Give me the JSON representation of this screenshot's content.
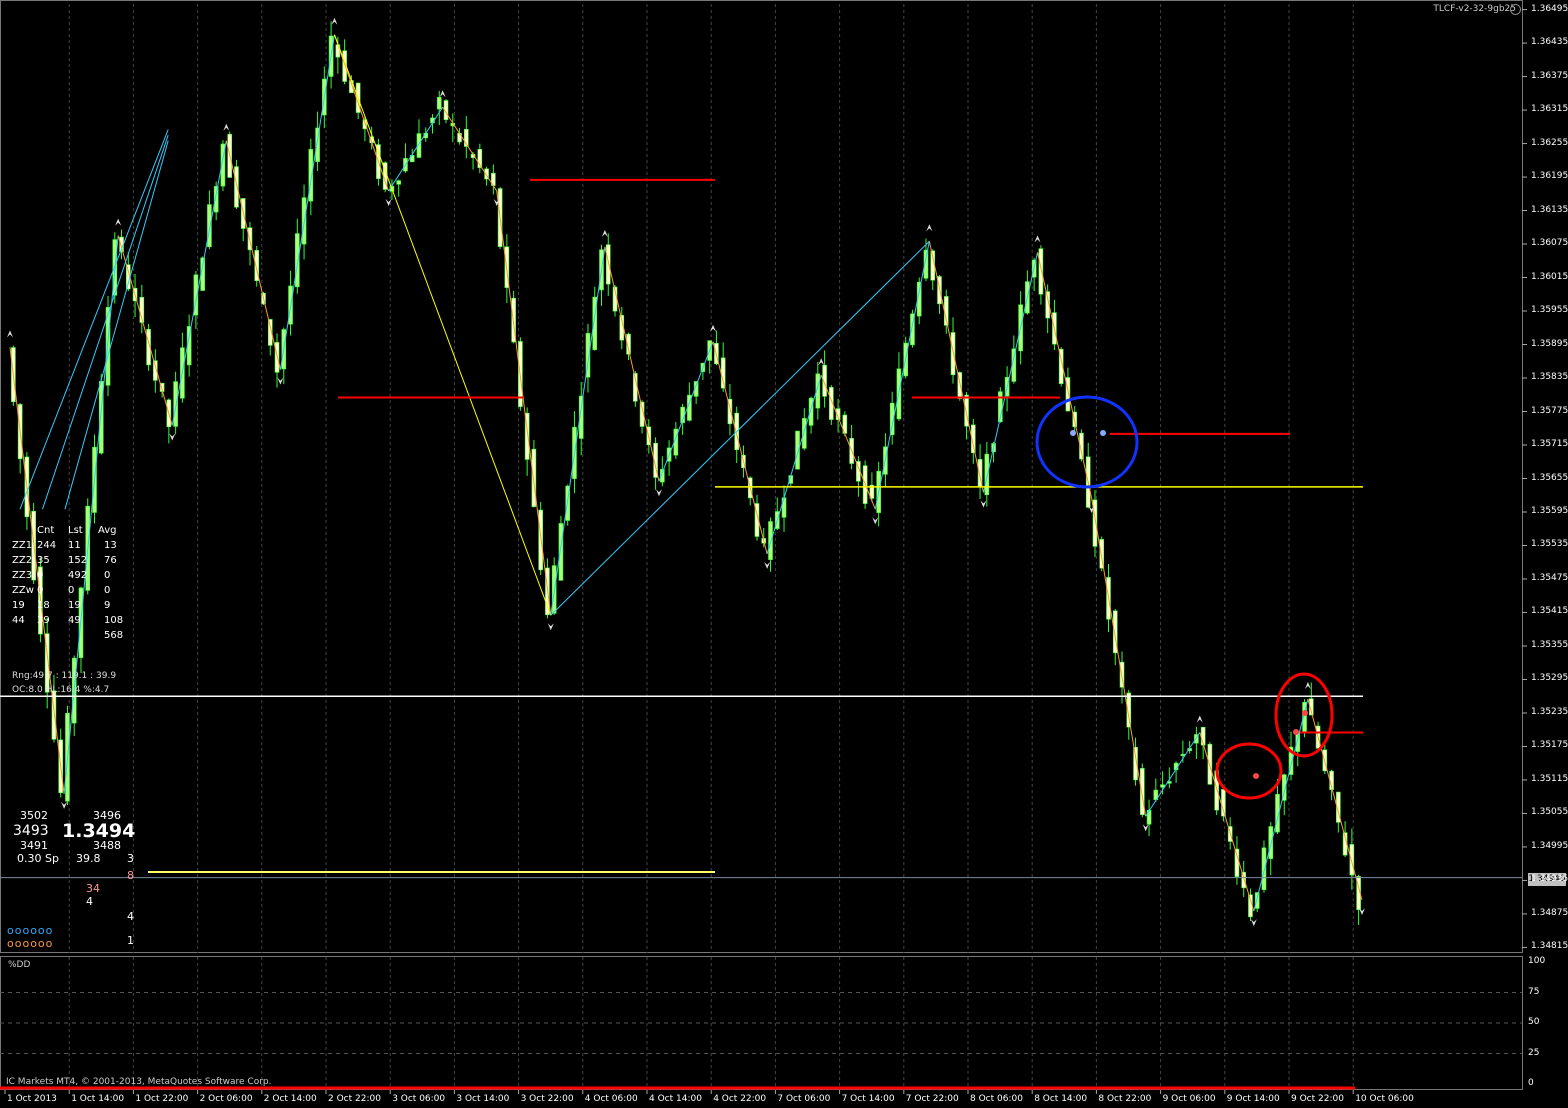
{
  "window": {
    "title": "TLCF-v2-32-9gb25",
    "copyright": "IC Markets MT4, © 2001-2013, MetaQuotes Software Corp."
  },
  "chart_data": {
    "type": "candlestick",
    "price_axis": [
      "1.36495",
      "1.36435",
      "1.36375",
      "1.36315",
      "1.36255",
      "1.36195",
      "1.36135",
      "1.36075",
      "1.36015",
      "1.35955",
      "1.35895",
      "1.35835",
      "1.35775",
      "1.35715",
      "1.35655",
      "1.35595",
      "1.35535",
      "1.35475",
      "1.35415",
      "1.35355",
      "1.35295",
      "1.35235",
      "1.35175",
      "1.35115",
      "1.35055",
      "1.34995",
      "1.34935",
      "1.34875",
      "1.34815"
    ],
    "ylim": [
      1.34805,
      1.36505
    ],
    "current_price": "1.34940",
    "time_axis": [
      "1 Oct 2013",
      "1 Oct 14:00",
      "1 Oct 22:00",
      "2 Oct 06:00",
      "2 Oct 14:00",
      "2 Oct 22:00",
      "3 Oct 06:00",
      "3 Oct 14:00",
      "3 Oct 22:00",
      "4 Oct 06:00",
      "4 Oct 14:00",
      "4 Oct 22:00",
      "7 Oct 06:00",
      "7 Oct 14:00",
      "7 Oct 22:00",
      "8 Oct 06:00",
      "8 Oct 14:00",
      "8 Oct 22:00",
      "9 Oct 06:00",
      "9 Oct 14:00",
      "9 Oct 22:00",
      "10 Oct 06:00"
    ],
    "zigzag_points": [
      [
        0,
        1.3589
      ],
      [
        1,
        1.3509
      ],
      [
        2,
        1.3609
      ],
      [
        3,
        1.3575
      ],
      [
        4,
        1.3626
      ],
      [
        5,
        1.3585
      ],
      [
        6,
        1.3645
      ],
      [
        7,
        1.3617
      ],
      [
        8,
        1.3632
      ],
      [
        9,
        1.3617
      ],
      [
        10,
        1.3541
      ],
      [
        11,
        1.3607
      ],
      [
        12,
        1.3565
      ],
      [
        13,
        1.359
      ],
      [
        14,
        1.3552
      ],
      [
        15,
        1.3584
      ],
      [
        16,
        1.356
      ],
      [
        17,
        1.3608
      ],
      [
        18,
        1.3563
      ],
      [
        19,
        1.3606
      ],
      [
        20,
        1.3562
      ],
      [
        21,
        1.3505
      ],
      [
        22,
        1.352
      ],
      [
        23,
        1.3488
      ],
      [
        24,
        1.3526
      ],
      [
        25,
        1.349
      ]
    ],
    "horizontal_levels": [
      {
        "price": 1.3619,
        "color": "#ff0000"
      },
      {
        "price": 1.358,
        "color": "#ff0000"
      },
      {
        "price": 1.358,
        "color": "#ff0000"
      },
      {
        "price": 1.35735,
        "color": "#ff0000"
      },
      {
        "price": 1.3564,
        "color": "#ffff00"
      },
      {
        "price": 1.35265,
        "color": "#ffffff"
      },
      {
        "price": 1.352,
        "color": "#ff0000"
      },
      {
        "price": 1.3495,
        "color": "#ffff66"
      }
    ],
    "indicator": {
      "name": "%DD",
      "ticks": [
        "100",
        "75",
        "50",
        "25",
        "0"
      ]
    }
  },
  "stats": {
    "headers": [
      "Cnt",
      "Lst",
      "Avg"
    ],
    "rows": [
      [
        "ZZ1",
        "244",
        "11",
        "13"
      ],
      [
        "ZZ2",
        "35",
        "152",
        "76"
      ],
      [
        "ZZ3",
        "0",
        "492",
        "0"
      ],
      [
        "ZZw",
        "0",
        "0",
        "0"
      ],
      [
        "19",
        "18",
        "19",
        "9"
      ],
      [
        "44",
        "39",
        "49",
        "108"
      ]
    ],
    "total": "568",
    "rng": "Rng:49.7 : 119.1 : 39.9",
    "oc": "OC:8.0 HL:16.4 %:4.7"
  },
  "quote": {
    "ask_high": "3502",
    "ask_high2": "3496",
    "bid_left": "3493",
    "bid_big": "1.3494",
    "low_left": "3491",
    "low_right": "3488",
    "spread": "0.30 Sp",
    "spread_val": "39.8",
    "spread_n": "3",
    "n8": "8",
    "n34": "34",
    "n4a": "4",
    "n4b": "4",
    "n1": "1",
    "blue_dots": "oooooo",
    "orange_dots": "oooooo"
  },
  "colors": {
    "bull": "#a8ff7a",
    "bear": "#ffffcc",
    "wick": "#33ff33",
    "zz_blue": "#33ccff",
    "zz_orange": "#ff9933",
    "zz_yellow": "#ffff00",
    "grid": "#444444"
  }
}
